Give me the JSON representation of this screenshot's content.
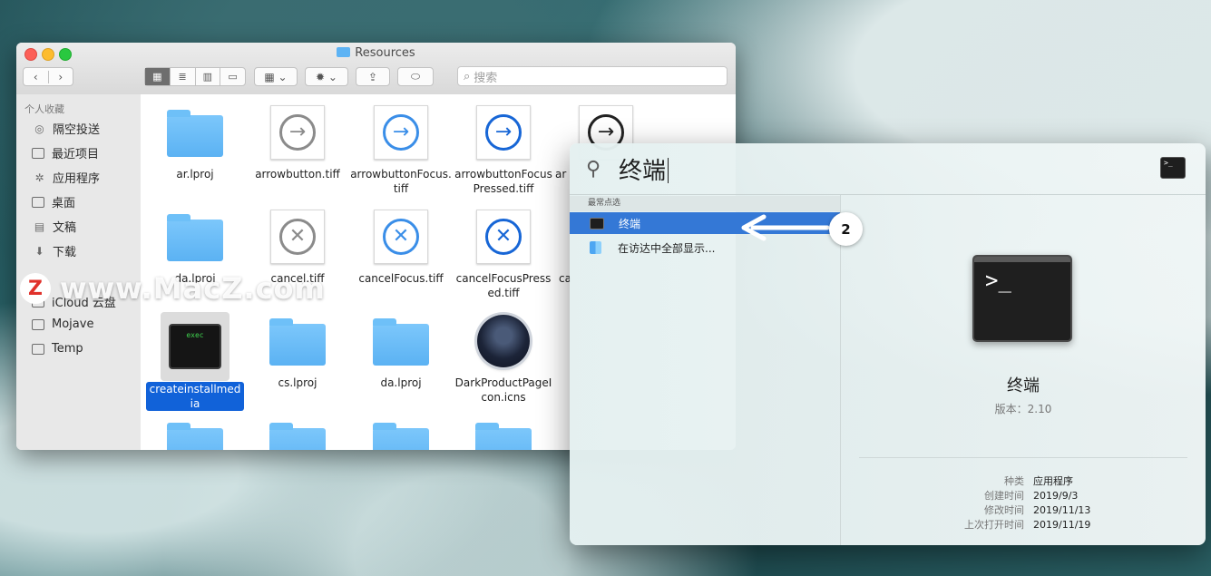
{
  "finder": {
    "title": "Resources",
    "search_placeholder": "搜索",
    "toolbar": {
      "back": "‹",
      "forward": "›",
      "view_icons": "▦",
      "view_list": "≣",
      "view_columns": "▥",
      "view_gallery": "▭",
      "group": "▦ ⌄",
      "action": "✹ ⌄",
      "share": "⇪",
      "tag": "⬭"
    },
    "sidebar": {
      "favorites_heading": "个人收藏",
      "favorites": [
        {
          "label": "隔空投送",
          "icon": "airdrop-icon"
        },
        {
          "label": "最近项目",
          "icon": "recents-icon"
        },
        {
          "label": "应用程序",
          "icon": "applications-icon"
        },
        {
          "label": "桌面",
          "icon": "desktop-icon"
        },
        {
          "label": "文稿",
          "icon": "documents-icon"
        },
        {
          "label": "下载",
          "icon": "downloads-icon"
        }
      ],
      "devices": [
        {
          "label": "iCloud 云盘",
          "icon": "icloud-icon"
        },
        {
          "label": "Mojave",
          "icon": "disk-icon"
        },
        {
          "label": "Temp",
          "icon": "disk-icon"
        }
      ]
    },
    "files": [
      "ar.lproj",
      "arrowbutton.tiff",
      "arrowbuttonFocus.tiff",
      "arrowbuttonFocusPressed.tiff",
      "ar",
      "da.lproj",
      "cancel.tiff",
      "cancelFocus.tiff",
      "cancelFocusPressed.tiff",
      "ca",
      "createinstallmedia",
      "cs.lproj",
      "da.lproj",
      "DarkProductPageIcon.icns"
    ],
    "exec_label": "exec"
  },
  "watermark": {
    "badge": "Z",
    "text": "www.MacZ.com"
  },
  "spotlight": {
    "query": "终端",
    "section_heading": "最常点选",
    "results": [
      {
        "label": "终端",
        "selected": true
      },
      {
        "label": "在访达中全部显示...",
        "selected": false
      }
    ],
    "step_badge": "2",
    "preview": {
      "terminal_prompt": ">_",
      "mini_prompt": ">_",
      "app_name": "终端",
      "version": "版本：2.10",
      "meta": [
        {
          "key": "种类",
          "value": "应用程序"
        },
        {
          "key": "创建时间",
          "value": "2019/9/3"
        },
        {
          "key": "修改时间",
          "value": "2019/11/13"
        },
        {
          "key": "上次打开时间",
          "value": "2019/11/19"
        }
      ]
    }
  },
  "colors": {
    "selection_blue": "#3478d6",
    "finder_selection": "#1162d9",
    "folder_blue": "#5bb2f3"
  }
}
